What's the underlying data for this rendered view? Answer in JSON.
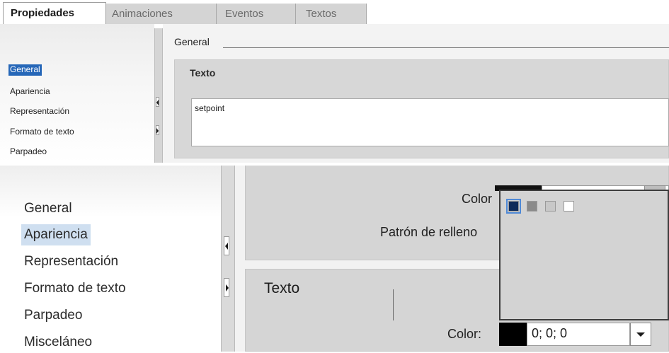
{
  "tabs": [
    {
      "label": "Propiedades"
    },
    {
      "label": "Animaciones"
    },
    {
      "label": "Eventos"
    },
    {
      "label": "Textos"
    }
  ],
  "top_panel": {
    "nav": [
      "General",
      "Apariencia",
      "Representación",
      "Formato de texto",
      "Parpadeo"
    ],
    "selected": "General",
    "section_title": "General",
    "group_title": "Texto",
    "text_value": "setpoint"
  },
  "bottom_panel": {
    "nav": [
      "General",
      "Apariencia",
      "Representación",
      "Formato de texto",
      "Parpadeo",
      "Misceláneo"
    ],
    "selected": "Apariencia",
    "color_label_top": "Color",
    "fill_pattern_label": "Patrón de relleno",
    "group_title": "Texto",
    "color_label": "Color:",
    "color_value": "0; 0; 0"
  },
  "palette": {
    "colors": [
      "#0d2a5a",
      "#8a8a8a",
      "#c8c8c8",
      "#ffffff"
    ],
    "selected_index": 0
  }
}
